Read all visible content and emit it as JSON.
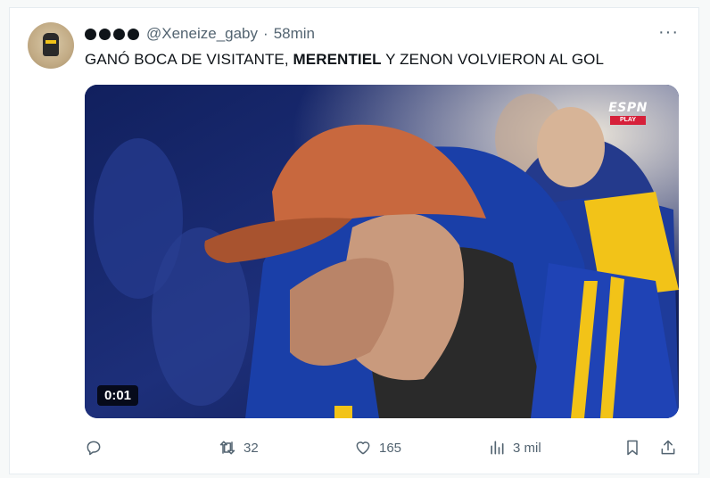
{
  "tweet": {
    "username": "@Xeneize_gaby",
    "separator": "·",
    "time": "58min",
    "more_label": "···",
    "text_before": "GANÓ BOCA DE VISITANTE, ",
    "text_bold": "MERENTIEL",
    "text_after": " Y ZENON VOLVIERON AL GOL"
  },
  "media": {
    "duration": "0:01",
    "broadcaster_logo": "ESPN",
    "broadcaster_sub": "PLAY"
  },
  "actions": {
    "reply": {
      "icon": "reply-icon",
      "count": ""
    },
    "retweet": {
      "icon": "retweet-icon",
      "count": "32"
    },
    "like": {
      "icon": "heart-icon",
      "count": "165"
    },
    "views": {
      "icon": "views-icon",
      "count": "3 mil"
    },
    "bookmark": {
      "icon": "bookmark-icon"
    },
    "share": {
      "icon": "share-icon"
    }
  },
  "colors": {
    "text": "#0f1419",
    "secondary": "#536471",
    "boca_blue": "#1a3fa8",
    "boca_yellow": "#f2c318",
    "cap": "#c8683e"
  }
}
